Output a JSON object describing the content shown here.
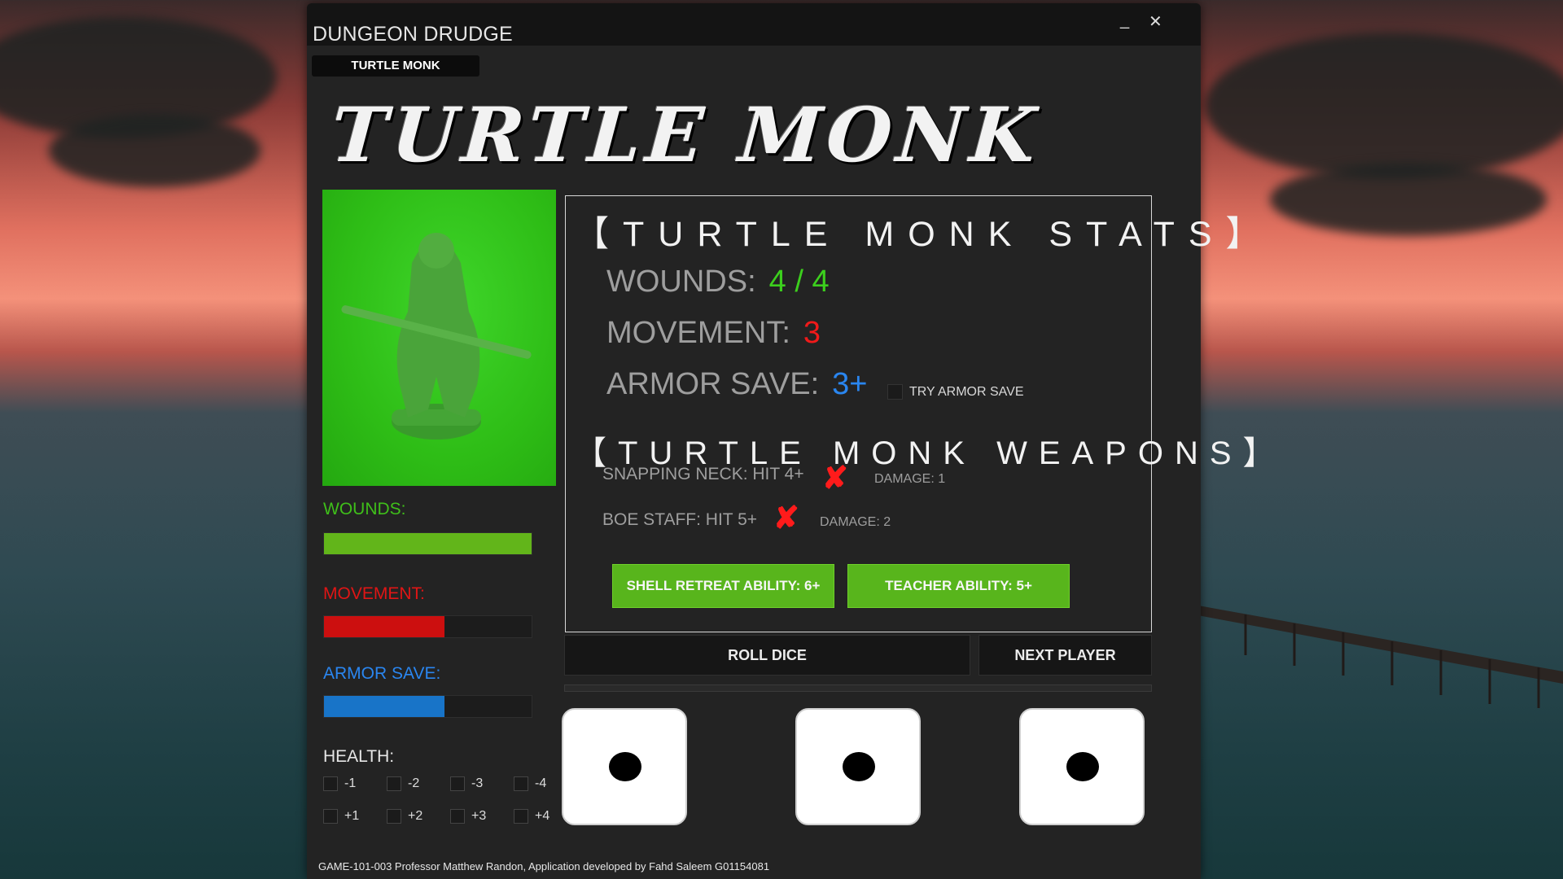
{
  "app": {
    "title": "DUNGEON DRUDGE",
    "minimize": "_",
    "close": "✕",
    "tab": "TURTLE MONK"
  },
  "hero": {
    "title": "TURTLE MONK",
    "portrait_icon": "turtle-monk-figure-icon"
  },
  "sidebar": {
    "wounds_label": "WOUNDS:",
    "movement_label": "MOVEMENT:",
    "armor_label": "ARMOR SAVE:",
    "wounds_fill": 1.0,
    "movement_fill": 0.58,
    "armor_fill": 0.58,
    "health_label": "HEALTH:",
    "health_neg": [
      "-1",
      "-2",
      "-3",
      "-4"
    ],
    "health_pos": [
      "+1",
      "+2",
      "+3",
      "+4"
    ],
    "colors": {
      "wounds": "#62b51a",
      "movement": "#cc0f0f",
      "armor": "#1874c8"
    }
  },
  "stats": {
    "heading": "【TURTLE MONK STATS】",
    "wounds_label": "WOUNDS:",
    "wounds_value": "4  /  4",
    "movement_label": "MOVEMENT:",
    "movement_value": "3",
    "armor_label": "ARMOR SAVE:",
    "armor_value": "3+",
    "try_armor_save": "TRY ARMOR SAVE",
    "colors": {
      "wounds": "#3ccf1d",
      "movement": "#f01a1a",
      "armor": "#2a86f0"
    }
  },
  "weapons": {
    "heading": "【TURTLE MONK WEAPONS】",
    "items": [
      {
        "name": "SNAPPING NECK: HIT 4+",
        "mark": "✘",
        "damage": "DAMAGE: 1"
      },
      {
        "name": "BOE STAFF: HIT 5+",
        "mark": "✘",
        "damage": "DAMAGE: 2"
      }
    ]
  },
  "abilities": {
    "shell": "SHELL RETREAT ABILITY: 6+",
    "teacher": "TEACHER ABILITY: 5+"
  },
  "controls": {
    "roll": "ROLL DICE",
    "next": "NEXT PLAYER"
  },
  "dice": [
    1,
    1,
    1
  ],
  "footer": "GAME-101-003 Professor Matthew Randon, Application developed by Fahd Saleem G01154081"
}
